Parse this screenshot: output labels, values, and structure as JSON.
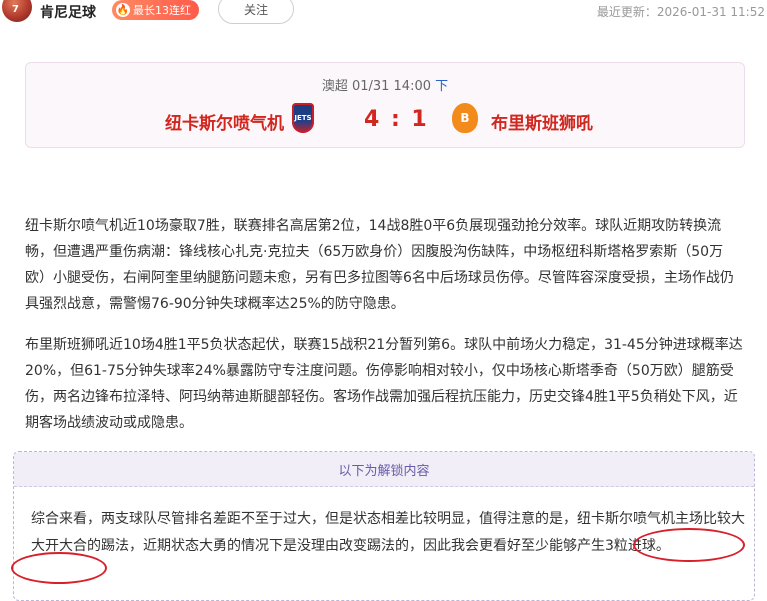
{
  "header": {
    "avatar_number": "7",
    "author": "肯尼足球",
    "badge": "最长13连红",
    "follow_label": "关注",
    "updated": "最近更新：2026-01-31 11:52"
  },
  "match": {
    "league_time": "澳超 01/31 14:00",
    "link": "下",
    "home_team": "纽卡斯尔喷气机",
    "away_team": "布里斯班狮吼",
    "score": "4 : 1",
    "home_logo_text": "JETS",
    "away_logo_text": "B"
  },
  "article": {
    "paragraph1": "纽卡斯尔喷气机近10场豪取7胜，联赛排名高居第2位，14战8胜0平6负展现强劲抢分效率。球队近期攻防转换流畅，但遭遇严重伤病潮：锋线核心扎克·克拉夫（65万欧身价）因腹股沟伤缺阵，中场枢纽科斯塔格罗索斯（50万欧）小腿受伤，右闸阿奎里纳腿筋问题未愈，另有巴多拉图等6名中后场球员伤停。尽管阵容深度受损，主场作战仍具强烈战意，需警惕76-90分钟失球概率达25%的防守隐患。",
    "paragraph2": "布里斯班狮吼近10场4胜1平5负状态起伏，联赛15战积21分暂列第6。球队中前场火力稳定，31-45分钟进球概率达20%，但61-75分钟失球率24%暴露防守专注度问题。伤停影响相对较小，仅中场核心斯塔季奇（50万欧）腿筋受伤，两名边锋布拉泽特、阿玛纳蒂迪斯腿部轻伤。客场作战需加强后程抗压能力，历史交锋4胜1平5负稍处下风，近期客场战绩波动或成隐患。"
  },
  "locked": {
    "header": "以下为解锁内容",
    "text": "综合来看，两支球队尽管排名差距不至于过大，但是状态相差比较明显，值得注意的是，纽卡斯尔喷气机主场比较大大开大合的踢法，近期状态大勇的情况下是没理由改变踢法的，因此我会更看好至少能够产生3粒进球。"
  }
}
